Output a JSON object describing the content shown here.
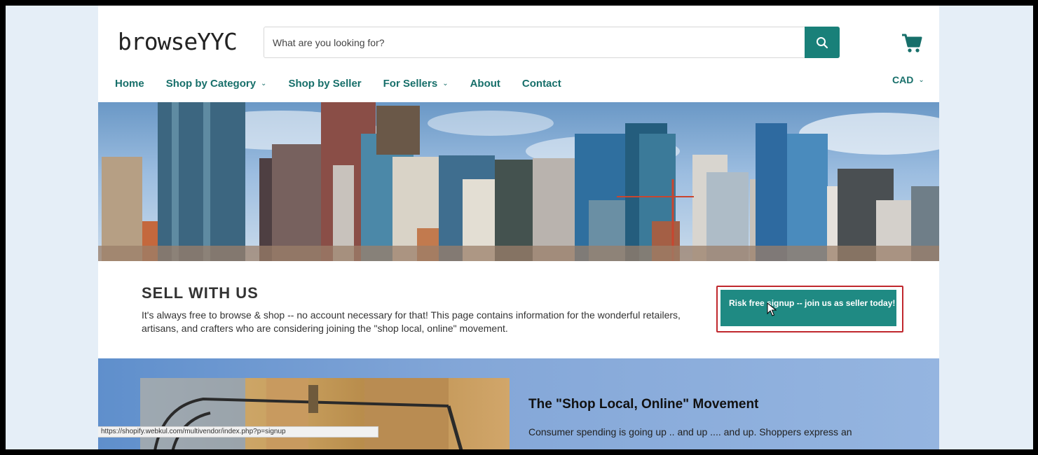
{
  "header": {
    "logo": "browseYYC",
    "search_placeholder": "What are you looking for?"
  },
  "nav": {
    "items": [
      {
        "label": "Home",
        "dropdown": false
      },
      {
        "label": "Shop by Category",
        "dropdown": true
      },
      {
        "label": "Shop by Seller",
        "dropdown": false
      },
      {
        "label": "For Sellers",
        "dropdown": true
      },
      {
        "label": "About",
        "dropdown": false
      },
      {
        "label": "Contact",
        "dropdown": false
      }
    ],
    "currency": "CAD"
  },
  "sell": {
    "title": "SELL WITH US",
    "text": "It's always free to browse & shop -- no account necessary for that!  This page contains information for the wonderful retailers, artisans, and crafters who are considering joining the \"shop local, online\" movement.",
    "signup_label": "Risk free signup -- join us as seller today!"
  },
  "movement": {
    "title": "The \"Shop Local, Online\" Movement",
    "text": "Consumer spending is going up .. and up .... and up.  Shoppers express an"
  },
  "status_bar": {
    "url": "https://shopify.webkul.com/multivendor/index.php?p=signup"
  },
  "colors": {
    "accent": "#198079",
    "nav_text": "#176f6a",
    "highlight": "#c0272d"
  }
}
